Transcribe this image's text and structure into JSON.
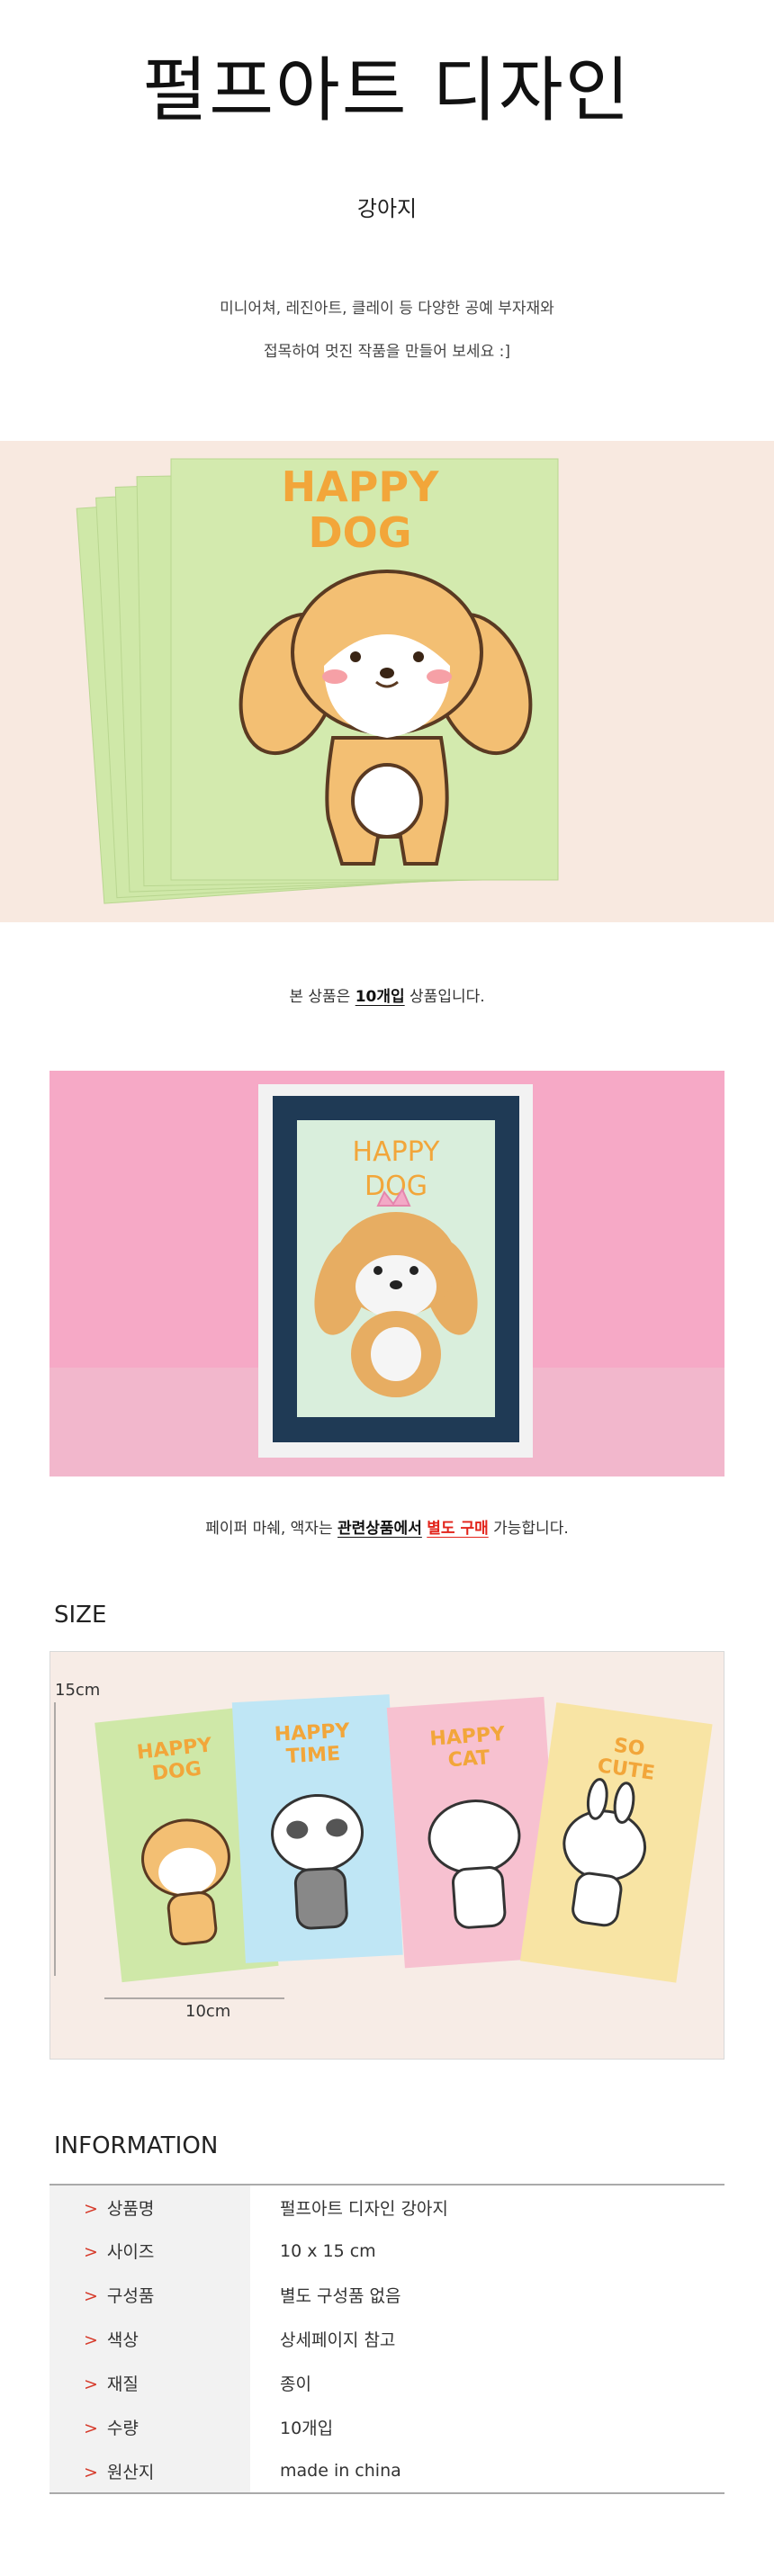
{
  "header": {
    "title": "펄프아트 디자인",
    "subtitle": "강아지",
    "desc_line1": "미니어쳐, 레진아트, 클레이 등 다양한 공예 부자재와",
    "desc_line2": "접목하여 멋진 작품을 만들어 보세요 :]"
  },
  "photo1": {
    "card_text_line1": "HAPPY",
    "card_text_line2": "DOG"
  },
  "note1": {
    "prefix": "본 상품은 ",
    "bold": "10개입",
    "suffix": " 상품입니다."
  },
  "photo2": {
    "card_text_line1": "HAPPY",
    "card_text_line2": "DOG"
  },
  "note2": {
    "prefix": "페이퍼 마쉐, 액자는 ",
    "underline": "관련상품에서",
    "space": " ",
    "red": "별도 구매",
    "suffix": " 가능합니다."
  },
  "size": {
    "title": "SIZE",
    "height_label": "15cm",
    "width_label": "10cm",
    "cards": [
      {
        "line1": "HAPPY",
        "line2": "DOG",
        "color": "#cfe8a8"
      },
      {
        "line1": "HAPPY",
        "line2": "TIME",
        "color": "#bfe6f5"
      },
      {
        "line1": "HAPPY",
        "line2": "CAT",
        "color": "#f7c1d0"
      },
      {
        "line1": "SO",
        "line2": "CUTE",
        "color": "#f8e4a4"
      }
    ]
  },
  "info": {
    "title": "INFORMATION",
    "arrow": ">",
    "rows": [
      {
        "key": "상품명",
        "value": "펄프아트 디자인 강아지"
      },
      {
        "key": "사이즈",
        "value": "10 x 15 cm"
      },
      {
        "key": "구성품",
        "value": "별도 구성품 없음"
      },
      {
        "key": "색상",
        "value": "상세페이지 참고"
      },
      {
        "key": "재질",
        "value": "종이"
      },
      {
        "key": "수량",
        "value": "10개입"
      },
      {
        "key": "원산지",
        "value": "made in china"
      }
    ]
  },
  "colors": {
    "card_green": "#cfe8a8",
    "text_orange": "#f2a63a",
    "red_accent": "#e2231a",
    "frame_navy": "#1f3a55",
    "pink_bg": "#f6a9c6"
  }
}
